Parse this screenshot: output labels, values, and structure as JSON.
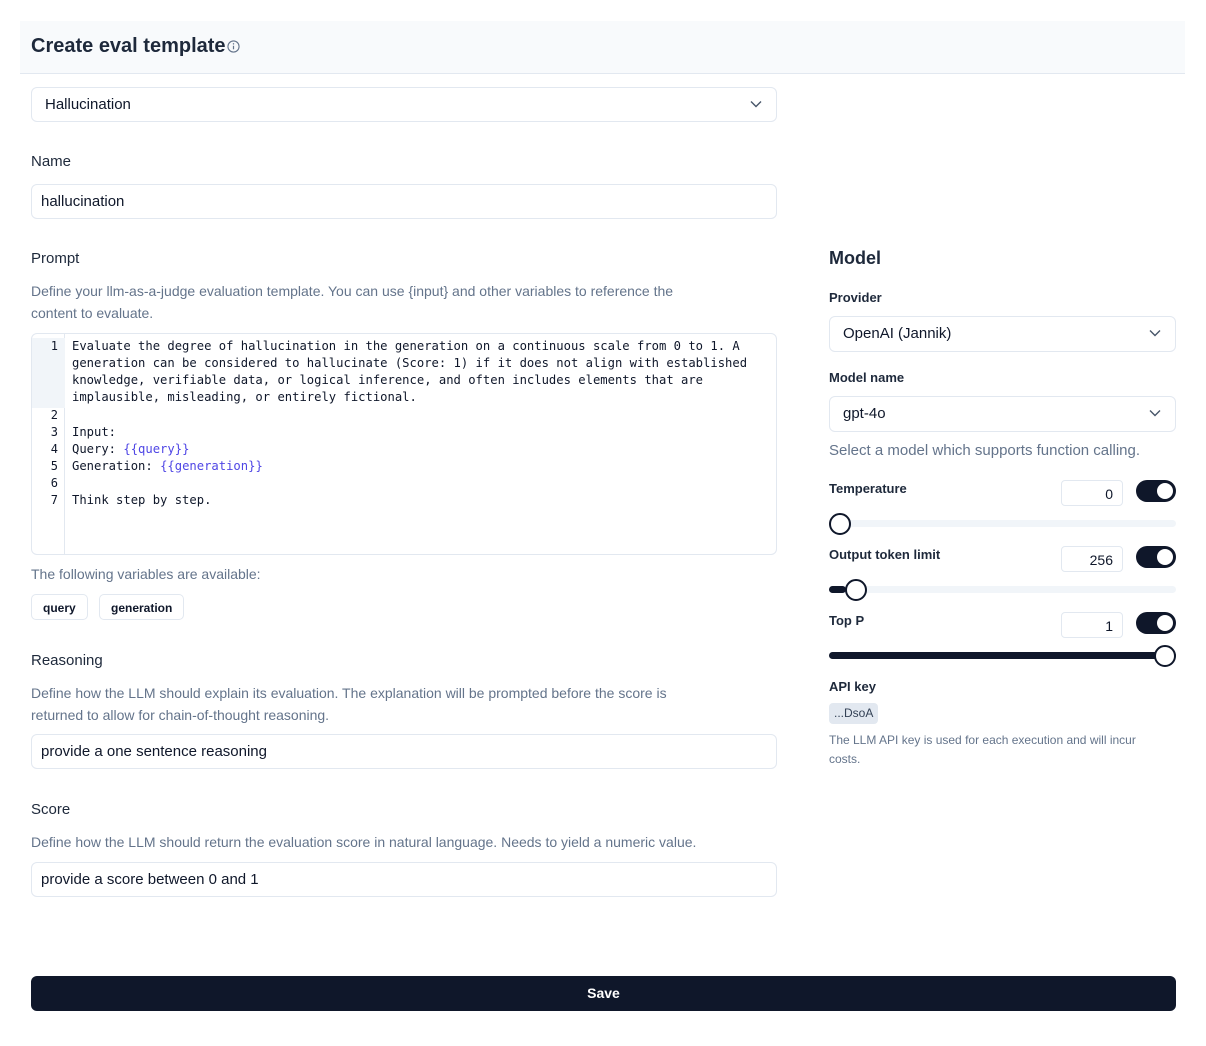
{
  "header": {
    "title": "Create eval template"
  },
  "template_select": {
    "value": "Hallucination"
  },
  "name": {
    "label": "Name",
    "value": "hallucination"
  },
  "prompt": {
    "label": "Prompt",
    "description_1": "Define your llm-as-a-judge evaluation template. You can use {input} and other variables to reference the",
    "description_2": "content to evaluate.",
    "line_numbers": [
      "1",
      "2",
      "3",
      "4",
      "5",
      "6",
      "7"
    ],
    "line1": [
      "Evaluate the degree of hallucination in the generation on a continuous scale from 0 to 1. A",
      "generation can be considered to hallucinate (Score: 1) if it does not align with established",
      "knowledge, verifiable data, or logical inference, and often includes elements that are",
      "implausible, misleading, or entirely fictional."
    ],
    "line3": "Input:",
    "line4_prefix": "Query: ",
    "line4_var": "{{query}}",
    "line5_prefix": "Generation: ",
    "line5_var": "{{generation}}",
    "line7": "Think step by step."
  },
  "variables": {
    "label": "The following variables are available:",
    "items": [
      "query",
      "generation"
    ]
  },
  "reasoning": {
    "label": "Reasoning",
    "description_1": "Define how the LLM should explain its evaluation. The explanation will be prompted before the score is",
    "description_2": "returned to allow for chain-of-thought reasoning.",
    "value": "provide a one sentence reasoning"
  },
  "score": {
    "label": "Score",
    "description": "Define how the LLM should return the evaluation score in natural language. Needs to yield a numeric value.",
    "value": "provide a score between 0 and 1"
  },
  "model": {
    "title": "Model",
    "provider_label": "Provider",
    "provider_value": "OpenAI (Jannik)",
    "model_name_label": "Model name",
    "model_name_value": "gpt-4o",
    "model_hint": "Select a model which supports function calling.",
    "temperature": {
      "label": "Temperature",
      "value": "0",
      "enabled": true,
      "slider_fraction": 0.0
    },
    "output_token_limit": {
      "label": "Output token limit",
      "value": "256",
      "enabled": true,
      "slider_fraction": 0.05
    },
    "top_p": {
      "label": "Top P",
      "value": "1",
      "enabled": true,
      "slider_fraction": 1.0
    },
    "api_key_label": "API key",
    "api_key_value": "...DsoA",
    "api_key_desc_1": "The LLM API key is used for each execution and will incur",
    "api_key_desc_2": "costs."
  },
  "save_label": "Save",
  "colors": {
    "primary": "#0f172a",
    "variable": "#4f46e5",
    "muted": "#64748b",
    "border": "#e2e8f0"
  }
}
